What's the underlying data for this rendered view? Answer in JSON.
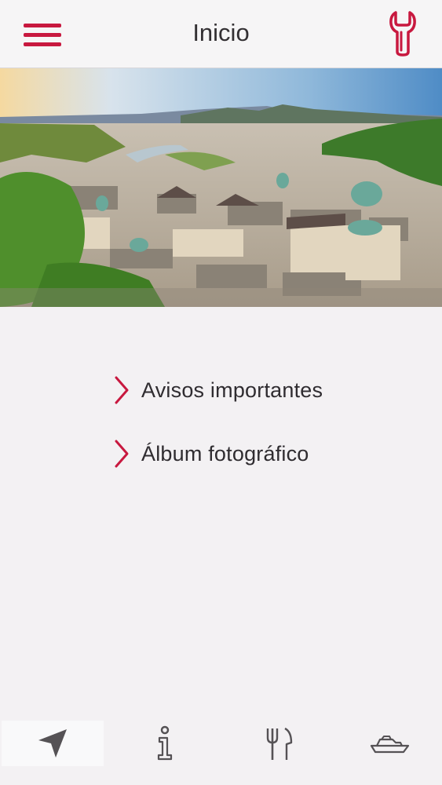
{
  "header": {
    "title": "Inicio",
    "menu_icon": "hamburger-menu-icon",
    "tools_icon": "wrench-icon"
  },
  "hero": {
    "description_icon": "city-panorama-photo"
  },
  "links": [
    {
      "label": "Avisos importantes",
      "icon": "chevron-right-icon"
    },
    {
      "label": "Álbum fotográfico",
      "icon": "chevron-right-icon"
    }
  ],
  "tabbar": {
    "tabs": [
      {
        "icon": "navigation-arrow-icon",
        "active": true
      },
      {
        "icon": "info-icon",
        "active": false
      },
      {
        "icon": "fork-knife-icon",
        "active": false
      },
      {
        "icon": "ship-icon",
        "active": false
      }
    ]
  },
  "colors": {
    "accent": "#c8183f",
    "background": "#f3f1f3",
    "text": "#2f2c30",
    "icon_gray": "#555255"
  }
}
